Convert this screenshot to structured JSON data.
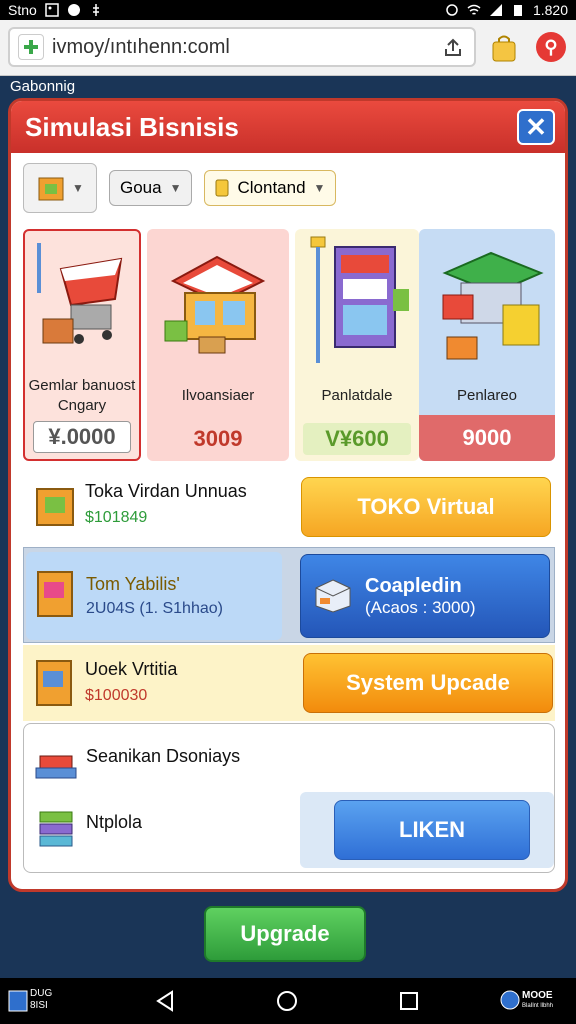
{
  "status_bar": {
    "carrier": "Stno",
    "time": "1.820"
  },
  "browser": {
    "url": "ivmoy/ıntıhenn:coml"
  },
  "page_label": "Gabonnig",
  "dialog": {
    "title": "Simulasi Bisnisis",
    "close_label": "✕",
    "filters": {
      "dropdown1": "Goua",
      "dropdown2": "Clontand"
    },
    "cards": [
      {
        "label_line1": "Gemlar banuost",
        "label_line2": "Cngary",
        "price": "¥.0000"
      },
      {
        "label": "Ilvoansiaer",
        "price": "3009"
      },
      {
        "label": "Panlatdale",
        "price": "V¥600"
      },
      {
        "label": "Penlareo",
        "price": "9000"
      }
    ],
    "rows": [
      {
        "title": "Toka Virdan Unnuas",
        "sub": "$101849",
        "button": "TOKO Virtual"
      },
      {
        "title": "Tom Yabilis'",
        "sub": "2U04S (1. S1hhao)",
        "button_title": "Coapledin",
        "button_sub": "(Acaos : 3000)"
      },
      {
        "title": "Uoek Vrtitia",
        "sub": "$100030",
        "button": "System Upcade"
      },
      {
        "title": "Seanikan Dsoniays",
        "title2": "Ntplola",
        "button": "LIKEN"
      }
    ]
  },
  "upgrade_button": "Upgrade",
  "nav": {
    "left_line1": "DUG",
    "left_line2": "8ISI",
    "right_line1": "MOOE",
    "right_line2": "BlaIlnt llbhh"
  }
}
